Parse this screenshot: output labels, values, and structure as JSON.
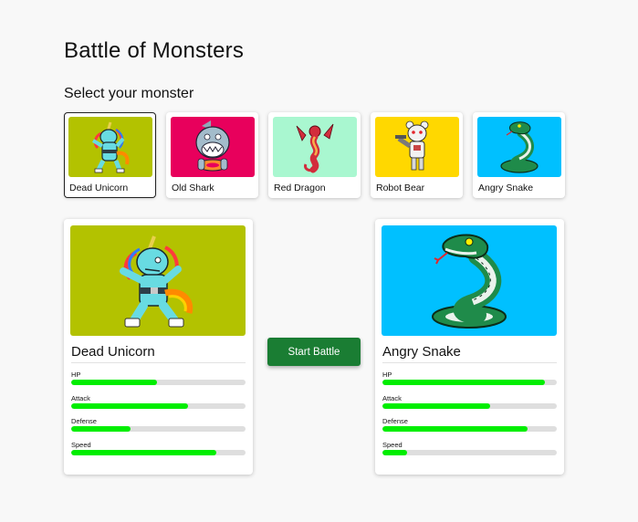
{
  "page": {
    "title": "Battle of Monsters",
    "subtitle": "Select your monster"
  },
  "monsters": [
    {
      "name": "Dead Unicorn",
      "bg": "#b3c200",
      "icon": "unicorn-monster-icon",
      "selected": true
    },
    {
      "name": "Old Shark",
      "bg": "#e8005c",
      "icon": "shark-monster-icon",
      "selected": false
    },
    {
      "name": "Red Dragon",
      "bg": "#a9f7d0",
      "icon": "dragon-monster-icon",
      "selected": false
    },
    {
      "name": "Robot Bear",
      "bg": "#ffd800",
      "icon": "robot-bear-monster-icon",
      "selected": false
    },
    {
      "name": "Angry Snake",
      "bg": "#00c0ff",
      "icon": "snake-monster-icon",
      "selected": false
    }
  ],
  "player": {
    "name": "Dead Unicorn",
    "bg": "#b3c200",
    "stats": [
      {
        "label": "HP",
        "value": 0.49
      },
      {
        "label": "Attack",
        "value": 0.67
      },
      {
        "label": "Defense",
        "value": 0.34
      },
      {
        "label": "Speed",
        "value": 0.83
      }
    ]
  },
  "computer": {
    "name": "Angry Snake",
    "bg": "#00c0ff",
    "stats": [
      {
        "label": "HP",
        "value": 0.93
      },
      {
        "label": "Attack",
        "value": 0.62
      },
      {
        "label": "Defense",
        "value": 0.83
      },
      {
        "label": "Speed",
        "value": 0.14
      }
    ]
  },
  "actions": {
    "start_label": "Start Battle"
  },
  "colors": {
    "stat_fill": "#00ee00",
    "stat_track": "#dedede",
    "button": "#1a7d33"
  }
}
